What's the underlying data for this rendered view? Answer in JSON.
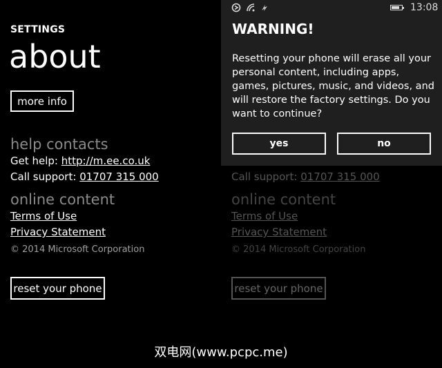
{
  "left": {
    "header": "SETTINGS",
    "title": "about",
    "more_info": "more info",
    "help_contacts": "help contacts",
    "get_help_label": "Get help:",
    "get_help_link": "http://m.ee.co.uk",
    "call_support_label": "Call support:",
    "call_support_number": "01707 315 000",
    "online_content": "online content",
    "terms": "Terms of Use",
    "privacy": "Privacy Statement",
    "copyright": "© 2014 Microsoft Corporation",
    "reset": "reset your phone"
  },
  "right": {
    "call_support_label": "Call support:",
    "call_support_number": "01707 315 000",
    "online_content": "online content",
    "terms": "Terms of Use",
    "privacy": "Privacy Statement",
    "copyright": "© 2014 Microsoft Corporation",
    "reset": "reset your phone"
  },
  "dialog": {
    "status_time": "13:08",
    "title": "WARNING!",
    "body": "Resetting your phone will erase all your personal content, including apps, games, pictures, music, and videos, and will restore the factory settings. Do you want to continue?",
    "yes": "yes",
    "no": "no"
  },
  "watermark": "双电网(www.pcpc.me)"
}
